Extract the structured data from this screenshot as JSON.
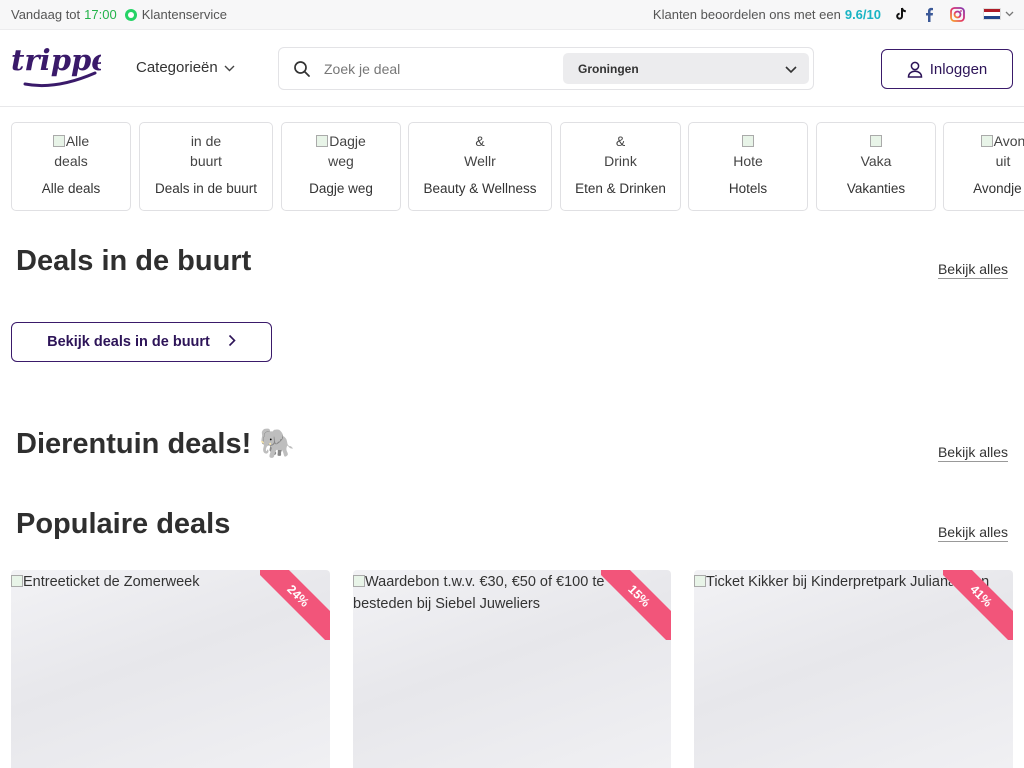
{
  "topbar": {
    "hours_prefix": "Vandaag tot",
    "hours_time": "17:00",
    "customer_service": "Klantenservice",
    "rating_prefix": "Klanten beoordelen ons met een",
    "rating_score": "9.6/10"
  },
  "header": {
    "logo_text": "tripper",
    "categories_label": "Categorieën",
    "search_placeholder": "Zoek je deal",
    "location": "Groningen",
    "login_label": "Inloggen"
  },
  "categories": [
    {
      "img_alt_1": "Alle",
      "img_alt_2": "deals",
      "label": "Alle deals"
    },
    {
      "img_alt_1": "in de",
      "img_alt_2": "buurt",
      "label": "Deals in de buurt"
    },
    {
      "img_alt_1": "Dagje",
      "img_alt_2": "weg",
      "label": "Dagje weg"
    },
    {
      "img_alt_1": "&",
      "img_alt_2": "Wellr",
      "label": "Beauty & Wellness"
    },
    {
      "img_alt_1": "&",
      "img_alt_2": "Drink",
      "label": "Eten & Drinken"
    },
    {
      "img_alt_1": "Hote",
      "img_alt_2": "",
      "label": "Hotels"
    },
    {
      "img_alt_1": "Vaka",
      "img_alt_2": "",
      "label": "Vakanties"
    },
    {
      "img_alt_1": "Avon",
      "img_alt_2": "uit",
      "label": "Avondje u"
    }
  ],
  "sections": {
    "nearby_title": "Deals in de buurt",
    "nearby_button": "Bekijk deals in de buurt",
    "zoo_title": "Dierentuin deals! 🐘",
    "popular_title": "Populaire deals",
    "see_all": "Bekijk alles"
  },
  "deals": [
    {
      "alt": "Entreeticket de Zomerweek",
      "discount": "24%"
    },
    {
      "alt": "Waardebon t.w.v. €30, €50 of €100 te besteden bij Siebel Juweliers",
      "discount": "15%"
    },
    {
      "alt": "Ticket Kikker bij Kinderpretpark Julianatoren",
      "discount": "41%"
    }
  ],
  "colors": {
    "brand_purple": "#3a1a6a",
    "accent_teal": "#19b4c4",
    "open_green": "#23b34a",
    "ribbon_pink": "#f2557a"
  }
}
